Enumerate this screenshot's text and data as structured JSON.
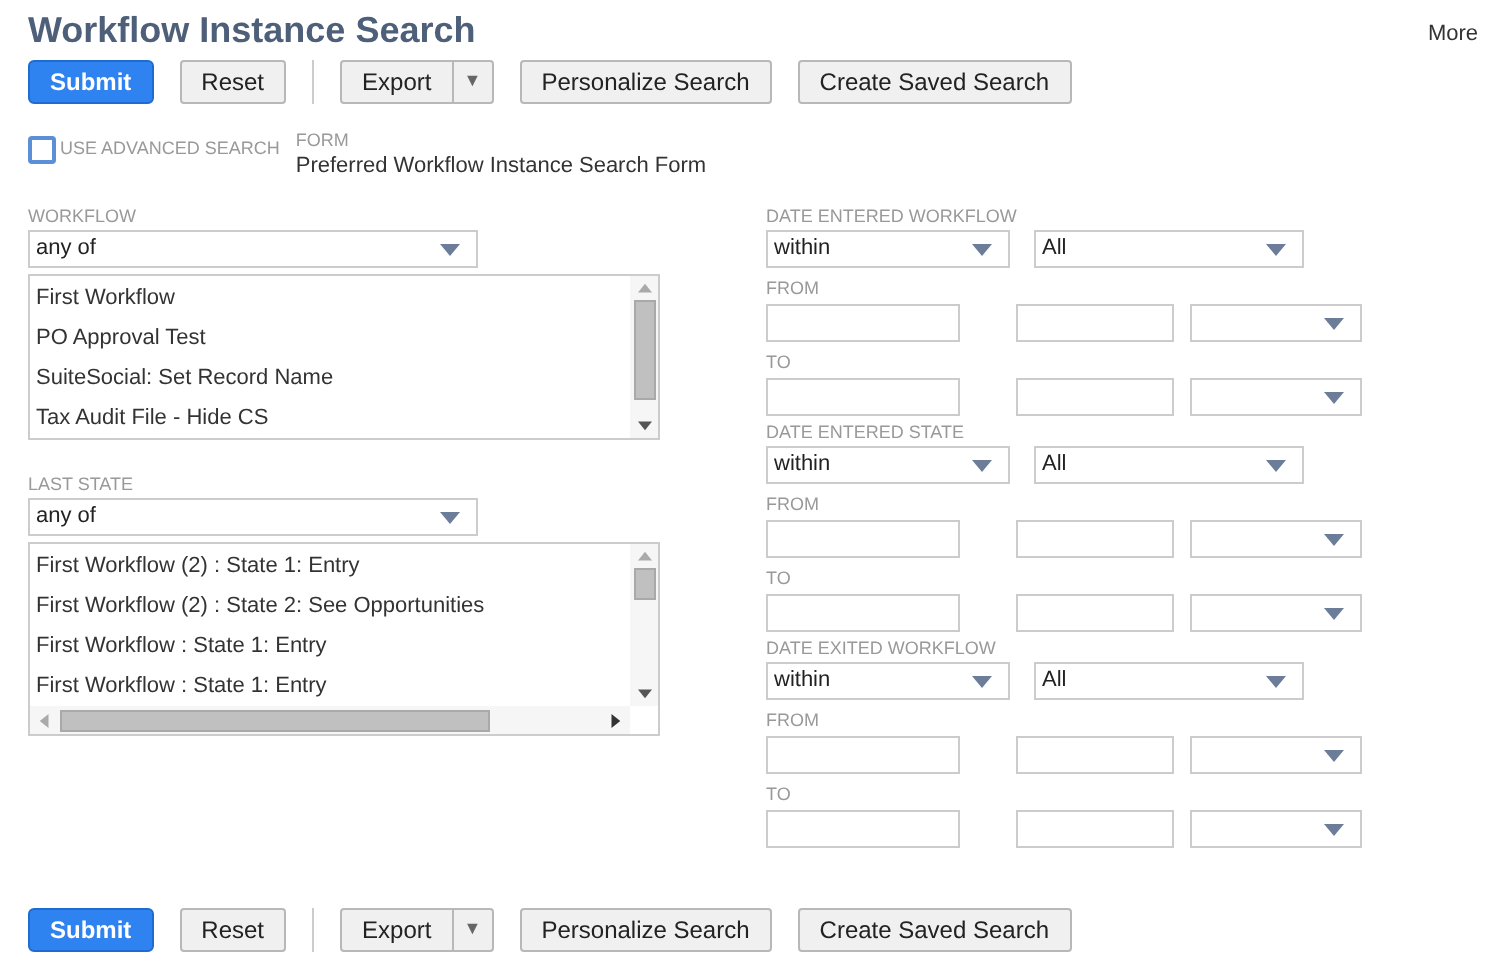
{
  "page": {
    "title": "Workflow Instance Search",
    "more_link": "More"
  },
  "top_toolbar": [
    {
      "kind": "primary",
      "label": "Submit"
    },
    {
      "kind": "plain",
      "label": "Reset"
    },
    {
      "kind": "separator"
    },
    {
      "kind": "split",
      "label": "Export",
      "arrow": "▼"
    },
    {
      "kind": "plain",
      "label": "Personalize Search"
    },
    {
      "kind": "plain",
      "label": "Create Saved Search"
    }
  ],
  "advanced_search": {
    "label": "USE ADVANCED SEARCH",
    "checked": false
  },
  "form": {
    "label": "FORM",
    "value": "Preferred Workflow Instance Search Form"
  },
  "multi_filters": [
    {
      "label": "WORKFLOW",
      "operator": "any of",
      "items": [
        "First Workflow",
        "PO Approval Test",
        "SuiteSocial: Set Record Name",
        "Tax Audit File - Hide CS"
      ],
      "horizontal_scroll": false
    },
    {
      "label": "LAST STATE",
      "operator": "any of",
      "items": [
        "First Workflow (2) : State 1: Entry",
        "First Workflow (2) : State 2: See Opportunities",
        "First Workflow : State 1: Entry",
        "First Workflow : State 1: Entry"
      ],
      "horizontal_scroll": true
    }
  ],
  "date_filters": [
    {
      "label": "DATE ENTERED WORKFLOW",
      "operator": "within",
      "range": "All",
      "from_label": "FROM",
      "to_label": "TO"
    },
    {
      "label": "DATE ENTERED STATE",
      "operator": "within",
      "range": "All",
      "from_label": "FROM",
      "to_label": "TO"
    },
    {
      "label": "DATE EXITED WORKFLOW",
      "operator": "within",
      "range": "All",
      "from_label": "FROM",
      "to_label": "TO"
    }
  ],
  "bottom_toolbar": [
    {
      "kind": "primary",
      "label": "Submit"
    },
    {
      "kind": "plain",
      "label": "Reset"
    },
    {
      "kind": "separator"
    },
    {
      "kind": "split",
      "label": "Export",
      "arrow": "▼"
    },
    {
      "kind": "plain",
      "label": "Personalize Search"
    },
    {
      "kind": "plain",
      "label": "Create Saved Search"
    }
  ]
}
